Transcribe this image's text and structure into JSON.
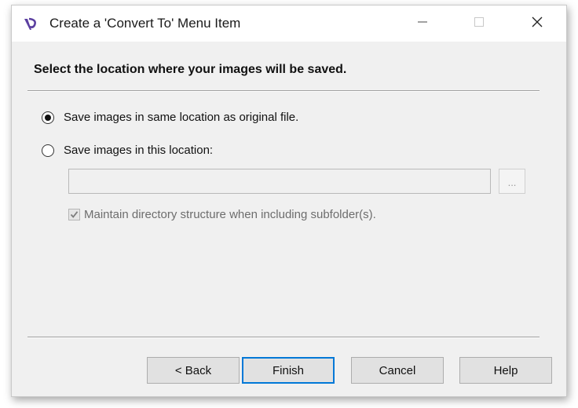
{
  "window": {
    "title": "Create a 'Convert To' Menu Item",
    "controls": {
      "minimize": "minimize-icon",
      "maximize": "maximize-icon",
      "close": "close-icon"
    },
    "app_icon": "app-logo-icon"
  },
  "page": {
    "heading": "Select the location where your images will be saved."
  },
  "options": {
    "same_location_label": "Save images in same location as original file.",
    "same_location_selected": true,
    "this_location_label": "Save images in this location:",
    "this_location_selected": false,
    "path_value": "",
    "browse_label": "...",
    "maintain_structure_label": "Maintain directory structure when including subfolder(s).",
    "maintain_structure_checked": true,
    "maintain_structure_enabled": false
  },
  "buttons": {
    "back": "< Back",
    "finish": "Finish",
    "cancel": "Cancel",
    "help": "Help"
  },
  "colors": {
    "window_bg": "#f0f0f0",
    "titlebar_bg": "#ffffff",
    "default_button_border": "#0078d7",
    "disabled_text": "#6d6d6d"
  }
}
